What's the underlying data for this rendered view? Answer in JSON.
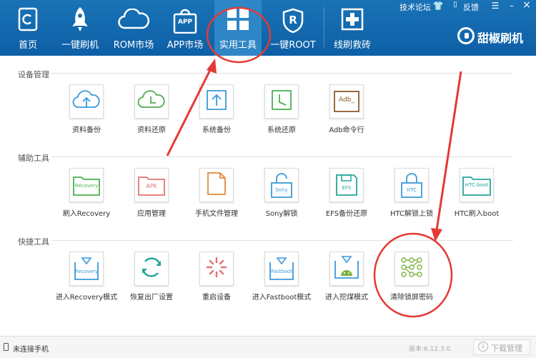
{
  "nav": [
    {
      "label": "首页",
      "icon": "home-icon"
    },
    {
      "label": "一键刷机",
      "icon": "rocket-icon"
    },
    {
      "label": "ROM市场",
      "icon": "cloud-icon"
    },
    {
      "label": "APP市场",
      "icon": "app-bag-icon",
      "badge": "APP"
    },
    {
      "label": "实用工具",
      "icon": "grid-icon"
    },
    {
      "label": "一键ROOT",
      "icon": "root-shield-icon",
      "badge": "R"
    },
    {
      "label": "线刷救砖",
      "icon": "brick-repair-icon"
    }
  ],
  "toplinks": {
    "forum": "技术论坛",
    "feedback": "反馈"
  },
  "window_buttons": {
    "skin": "👕",
    "menu": "☰",
    "minimize": "–",
    "close": "×"
  },
  "brand": {
    "name": "甜椒刷机"
  },
  "sections": [
    {
      "title": "设备管理",
      "tools": [
        {
          "label": "资料备份",
          "icon": "cloud-upload-icon"
        },
        {
          "label": "资料还原",
          "icon": "cloud-clock-icon"
        },
        {
          "label": "系统备份",
          "icon": "upload-box-icon"
        },
        {
          "label": "系统还原",
          "icon": "clock-box-icon"
        },
        {
          "label": "Adb命令行",
          "icon": "adb-terminal-icon",
          "badge": "Adb_"
        }
      ]
    },
    {
      "title": "辅助工具",
      "tools": [
        {
          "label": "刷入Recovery",
          "icon": "recovery-folder-icon",
          "badge": "Recovery"
        },
        {
          "label": "应用管理",
          "icon": "apk-folder-icon",
          "badge": "APK"
        },
        {
          "label": "手机文件管理",
          "icon": "file-icon"
        },
        {
          "label": "Sony解锁",
          "icon": "sony-unlock-icon",
          "badge": "Sony"
        },
        {
          "label": "EFS备份还原",
          "icon": "efs-disk-icon",
          "badge": "EFS"
        },
        {
          "label": "HTC解锁上锁",
          "icon": "htc-lock-icon",
          "badge": "HTC"
        },
        {
          "label": "HTC刷入boot",
          "icon": "htc-boot-icon",
          "badge": "HTC-boot"
        }
      ]
    },
    {
      "title": "快捷工具",
      "tools": [
        {
          "label": "进入Recovery模式",
          "icon": "recovery-mode-icon",
          "badge": "Recovery"
        },
        {
          "label": "恢复出厂设置",
          "icon": "factory-reset-icon"
        },
        {
          "label": "重启设备",
          "icon": "reboot-icon"
        },
        {
          "label": "进入Fastboot模式",
          "icon": "fastboot-mode-icon",
          "badge": "Fastboot"
        },
        {
          "label": "进入挖煤模式",
          "icon": "download-mode-icon"
        },
        {
          "label": "清除锁屏密码",
          "icon": "pattern-lock-icon"
        }
      ]
    }
  ],
  "status": {
    "device": "未连接手机",
    "version": "版本:6.12.3.0",
    "download": "下载管理"
  },
  "colors": {
    "titlebar": "#1a73b6",
    "active_tab": "#2f86c6",
    "annotation": "#e53935",
    "icon_blue": "#3a9ad9",
    "icon_green": "#4caf50",
    "icon_orange": "#e08a3c"
  }
}
